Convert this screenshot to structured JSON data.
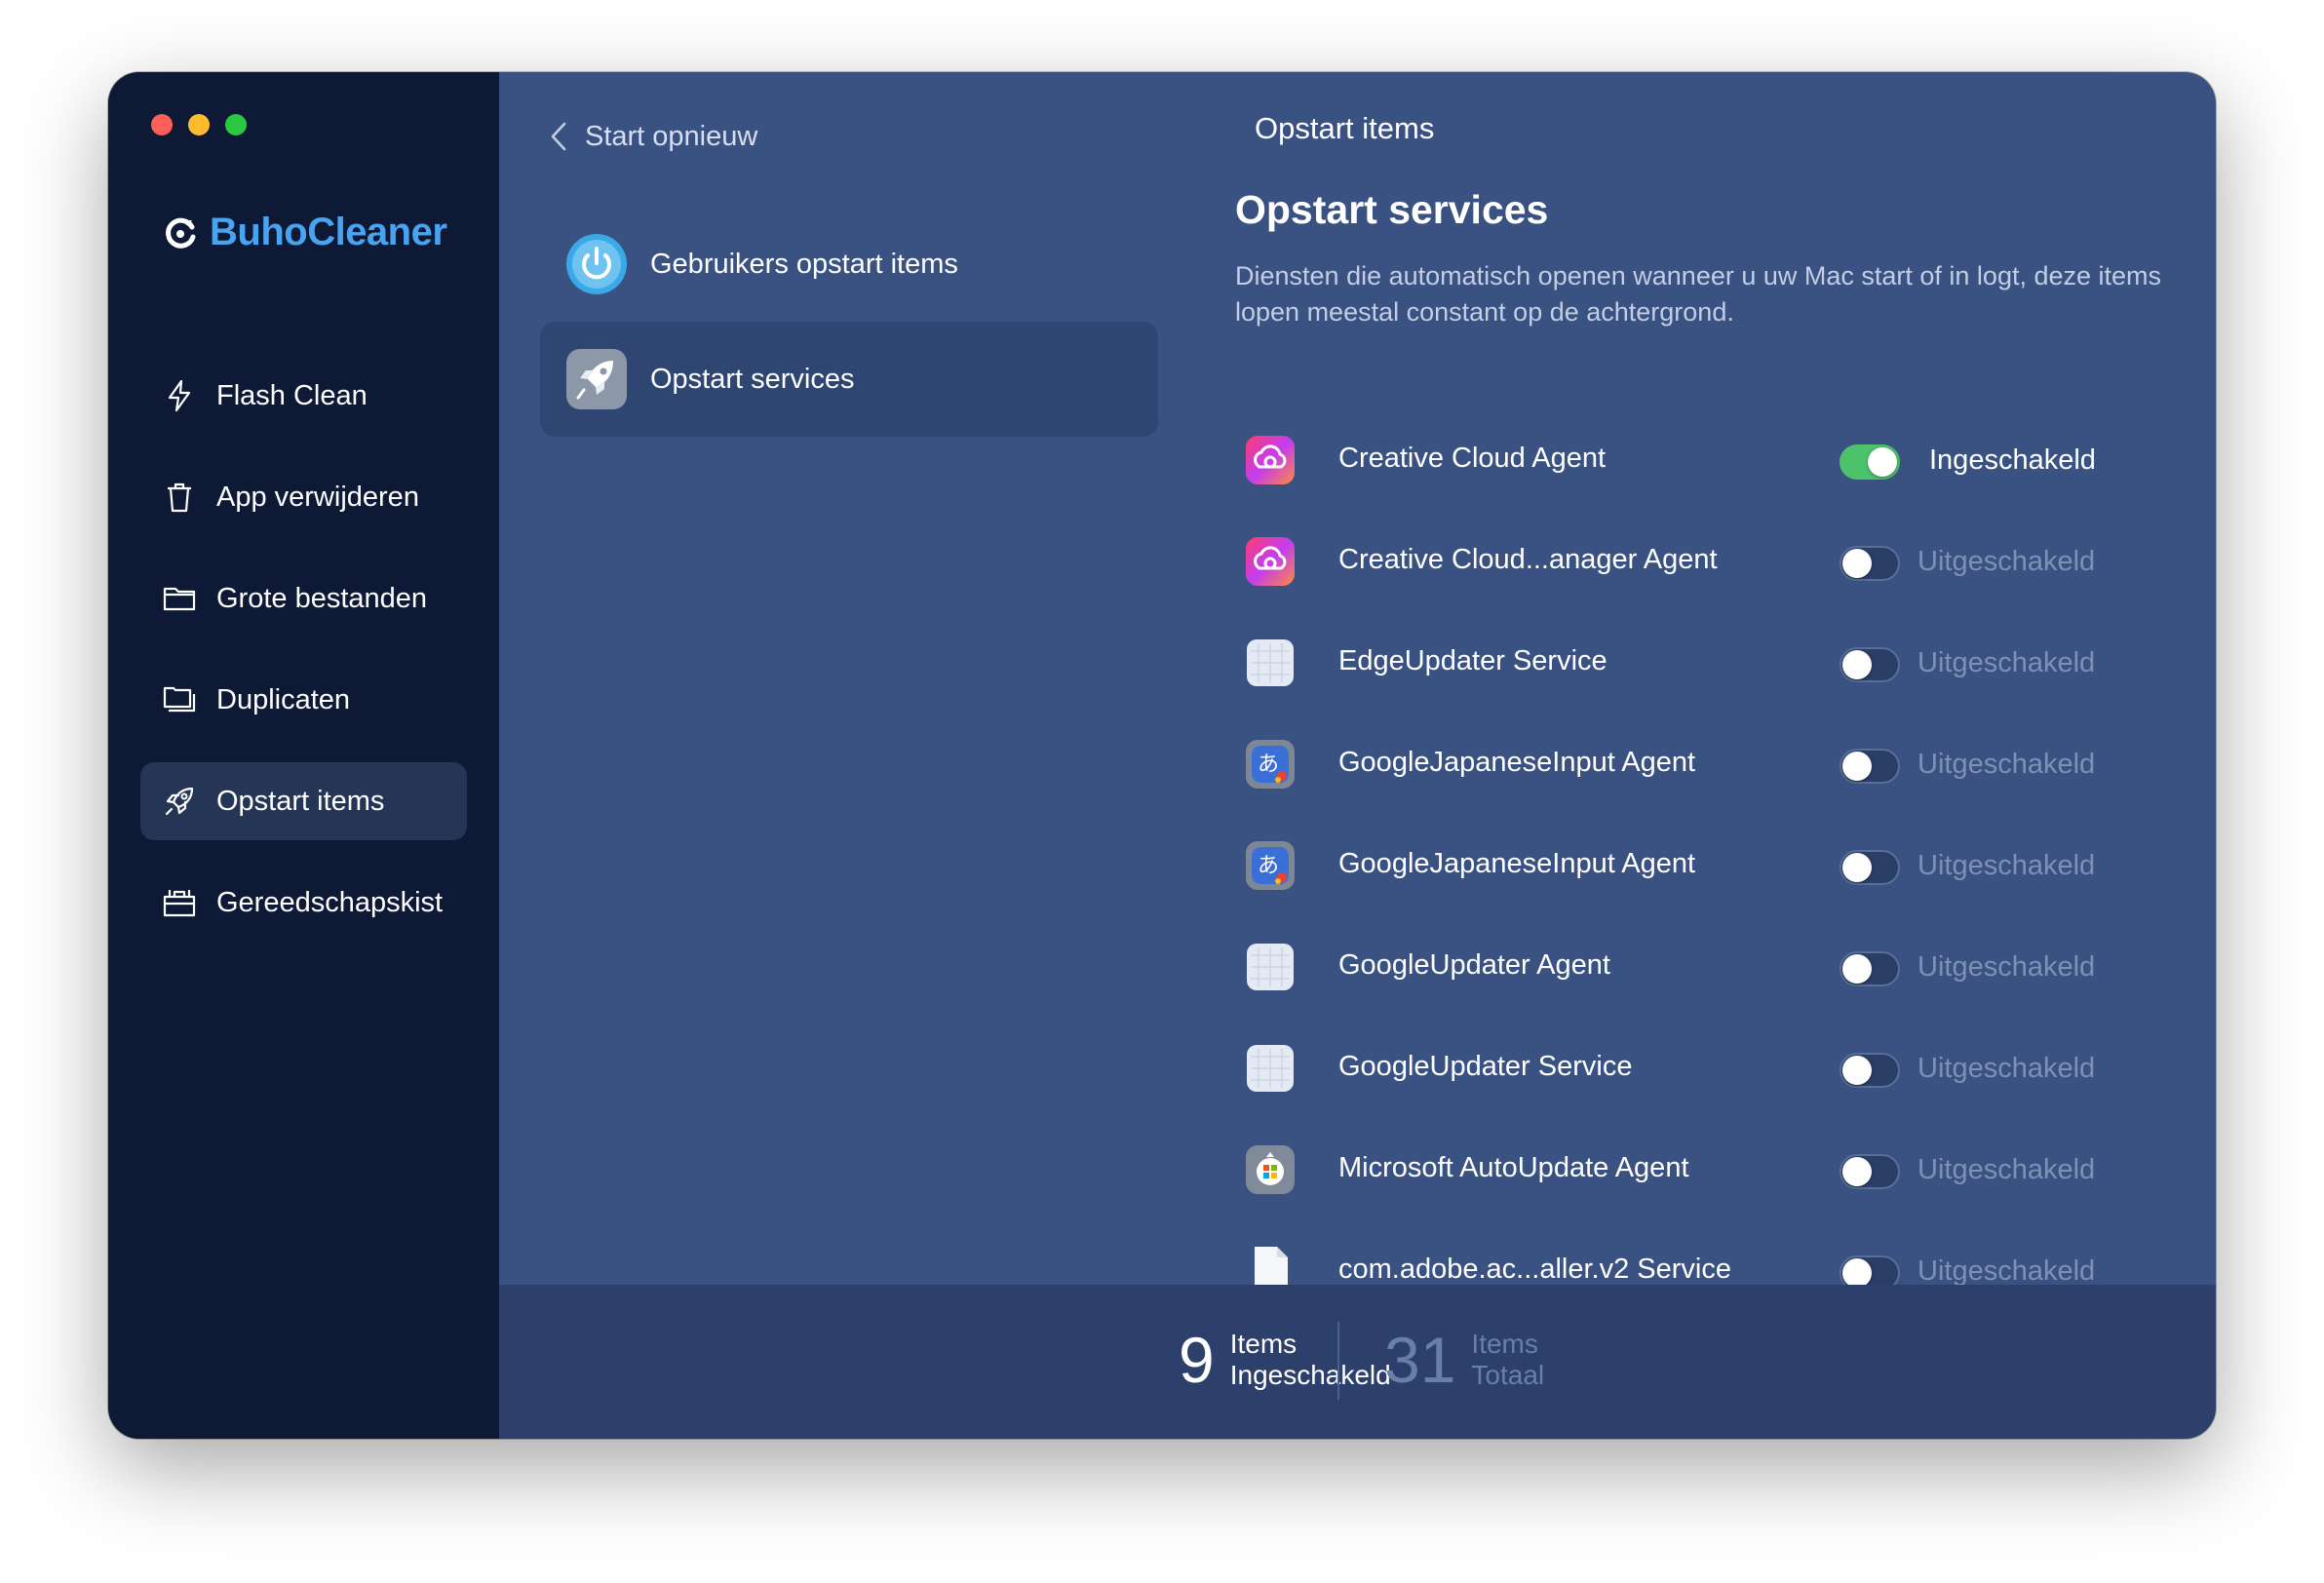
{
  "window": {
    "traffic_lights": [
      "close",
      "minimize",
      "zoom"
    ]
  },
  "app": {
    "name": "BuhoCleaner",
    "brand_color": "#4aa3f0"
  },
  "sidebar": {
    "items": [
      {
        "label": "Flash Clean",
        "icon": "lightning-icon",
        "active": false
      },
      {
        "label": "App verwijderen",
        "icon": "trash-icon",
        "active": false
      },
      {
        "label": "Grote bestanden",
        "icon": "folder-icon",
        "active": false
      },
      {
        "label": "Duplicaten",
        "icon": "duplicate-folder-icon",
        "active": false
      },
      {
        "label": "Opstart items",
        "icon": "rocket-icon",
        "active": true
      },
      {
        "label": "Gereedschapskist",
        "icon": "toolbox-icon",
        "active": false
      }
    ]
  },
  "middle": {
    "back_label": "Start opnieuw",
    "categories": [
      {
        "label": "Gebruikers opstart items",
        "icon": "power-icon",
        "active": false
      },
      {
        "label": "Opstart services",
        "icon": "rocket-icon",
        "active": true
      }
    ]
  },
  "header": {
    "title": "Opstart items"
  },
  "section": {
    "title": "Opstart services",
    "description": "Diensten die automatisch openen wanneer u uw Mac start of in logt, deze items lopen meestal constant op de achtergrond."
  },
  "services": [
    {
      "name": "Creative Cloud Agent",
      "icon": "creative-cloud-icon",
      "enabled": true,
      "status": "Ingeschakeld"
    },
    {
      "name": "Creative Cloud...anager Agent",
      "icon": "creative-cloud-icon",
      "enabled": false,
      "status": "Uitgeschakeld"
    },
    {
      "name": "EdgeUpdater Service",
      "icon": "generic-app-icon",
      "enabled": false,
      "status": "Uitgeschakeld"
    },
    {
      "name": "GoogleJapaneseInput Agent",
      "icon": "japanese-input-icon",
      "enabled": false,
      "status": "Uitgeschakeld"
    },
    {
      "name": "GoogleJapaneseInput Agent",
      "icon": "japanese-input-icon",
      "enabled": false,
      "status": "Uitgeschakeld"
    },
    {
      "name": "GoogleUpdater Agent",
      "icon": "generic-app-icon",
      "enabled": false,
      "status": "Uitgeschakeld"
    },
    {
      "name": "GoogleUpdater Service",
      "icon": "generic-app-icon",
      "enabled": false,
      "status": "Uitgeschakeld"
    },
    {
      "name": "Microsoft AutoUpdate Agent",
      "icon": "microsoft-autoupdate-icon",
      "enabled": false,
      "status": "Uitgeschakeld"
    },
    {
      "name": "com.adobe.ac...aller.v2 Service",
      "icon": "document-icon",
      "enabled": false,
      "status": "Uitgeschakeld"
    }
  ],
  "footer": {
    "enabled_count": "9",
    "enabled_label_1": "Items",
    "enabled_label_2": "Ingeschakeld",
    "total_count": "31",
    "total_label_1": "Items",
    "total_label_2": "Totaal"
  },
  "colors": {
    "sidebar_bg": "#0e1936",
    "panel_bg": "#3a5282",
    "footer_bg": "#2d406c",
    "toggle_on": "#4cc26a",
    "status_off": "#7f90b6"
  }
}
